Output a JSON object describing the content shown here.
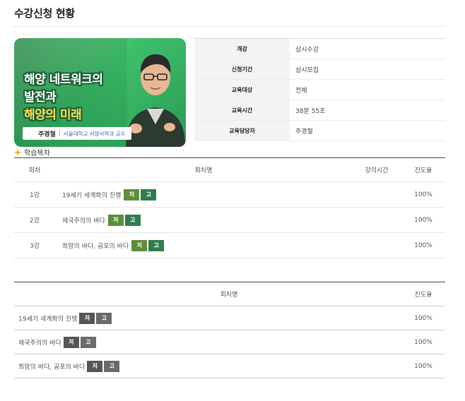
{
  "page": {
    "title": "수강신청 현황"
  },
  "thumbnail": {
    "title_lines": [
      "해양 네트워크의",
      "발전과",
      "해양의 미래"
    ],
    "lecturer_name": "주경철",
    "lecturer_affiliation": "서울대학교 서양사학과 교수"
  },
  "info": {
    "rows": [
      {
        "key": "개강",
        "value": "상시수강"
      },
      {
        "key": "신청기간",
        "value": "상시모집"
      },
      {
        "key": "교육대상",
        "value": "전체"
      },
      {
        "key": "교육시간",
        "value": "38분 55초"
      },
      {
        "key": "교육담당자",
        "value": "주경철"
      }
    ]
  },
  "toc": {
    "label": "학습목차"
  },
  "table1": {
    "headers": {
      "no": "회차",
      "title": "회차명",
      "time": "강의시간",
      "progress": "진도율"
    },
    "rows": [
      {
        "no": "1강",
        "title": "19세기 세계화의 진행",
        "btn1": "저",
        "btn2": "고",
        "time": "",
        "progress": "100%"
      },
      {
        "no": "2강",
        "title": "제국주의의 바다",
        "btn1": "저",
        "btn2": "고",
        "time": "",
        "progress": "100%"
      },
      {
        "no": "3강",
        "title": "희망의 바다, 공포의 바다",
        "btn1": "저",
        "btn2": "고",
        "time": "",
        "progress": "100%"
      }
    ]
  },
  "table2": {
    "headers": {
      "title": "회차명",
      "progress": "진도율"
    },
    "rows": [
      {
        "title": "19세기 세계화의 진행",
        "btn1": "저",
        "btn2": "고",
        "progress": "100%"
      },
      {
        "title": "제국주의의 바다",
        "btn1": "저",
        "btn2": "고",
        "progress": "100%"
      },
      {
        "title": "희망의 바다, 공포의 바다",
        "btn1": "저",
        "btn2": "고",
        "progress": "100%"
      }
    ]
  },
  "colors": {
    "accent_green": "#2f7d4f",
    "button_olive": "#5f8d3a",
    "button_gray": "#555555",
    "thumbnail_green": "#3fbf6a"
  }
}
